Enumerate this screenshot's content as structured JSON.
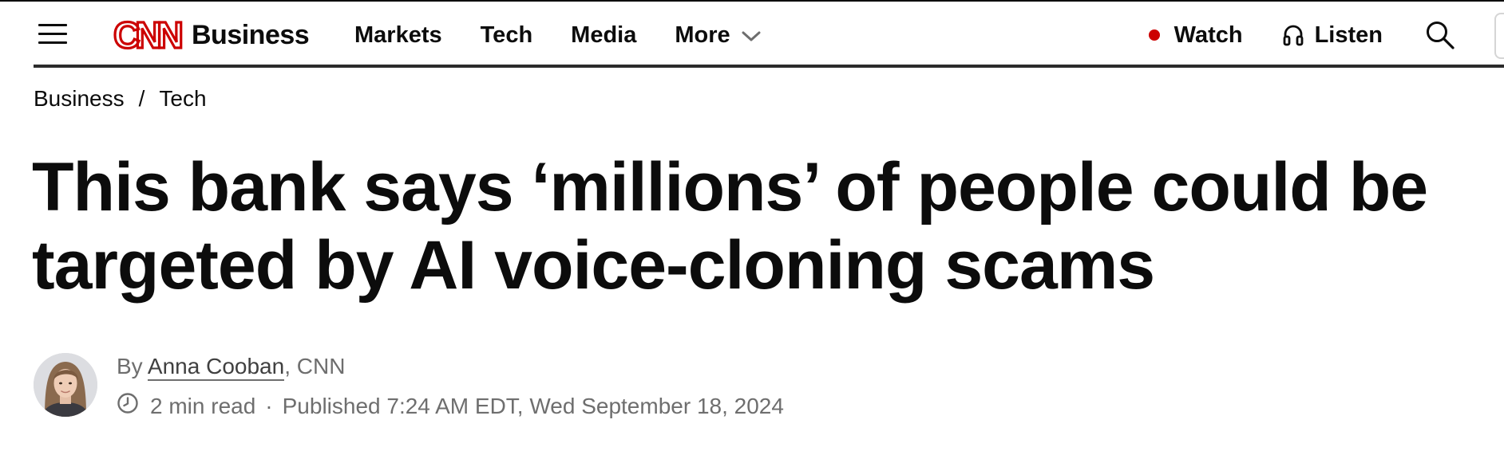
{
  "header": {
    "logo_text": "CNN",
    "section": "Business",
    "nav": [
      "Markets",
      "Tech",
      "Media",
      "More"
    ],
    "watch_label": "Watch",
    "listen_label": "Listen"
  },
  "breadcrumb": [
    "Business",
    "Tech"
  ],
  "article": {
    "headline": "This bank says ‘millions’ of people could be targeted by AI voice-cloning scams",
    "by_prefix": "By ",
    "author": "Anna Cooban",
    "author_suffix": ", CNN",
    "read_time": "2 min read",
    "separator": "·",
    "published": "Published 7:24 AM EDT, Wed September 18, 2024"
  },
  "colors": {
    "brand_red": "#cc0000",
    "text": "#0c0c0c",
    "meta_gray": "#6e6e6e"
  },
  "icons": [
    "menu-icon",
    "chevron-down-icon",
    "live-dot-icon",
    "headphones-icon",
    "search-icon",
    "clock-icon"
  ]
}
